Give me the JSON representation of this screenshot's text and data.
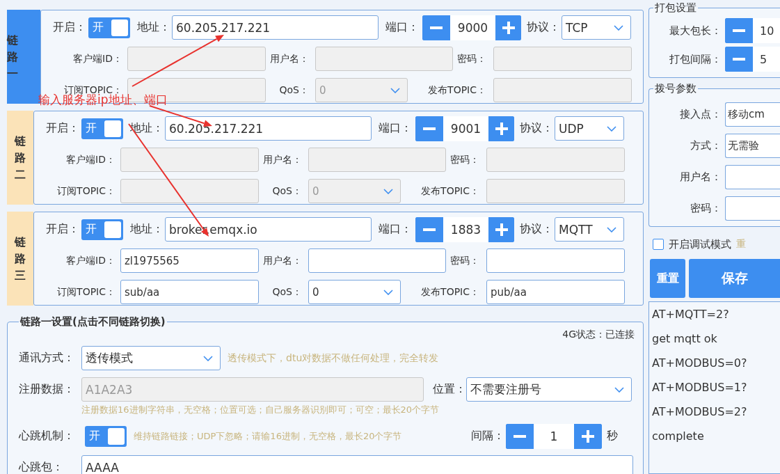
{
  "links": [
    {
      "tab": "链路一",
      "selected": true,
      "enabled": true,
      "switch_text": "开",
      "enable_label": "开启：",
      "address_label": "地址：",
      "address": "60.205.217.221",
      "port_label": "端口：",
      "port": "9000",
      "protocol_label": "协议：",
      "protocol": "TCP",
      "client_id_label": "客户端ID：",
      "username_label": "用户名：",
      "password_label": "密码：",
      "sub_topic_label": "订阅TOPIC：",
      "qos_label": "QoS：",
      "qos": "0",
      "pub_topic_label": "发布TOPIC：",
      "mqtt_disabled": true
    },
    {
      "tab": "链路二",
      "selected": false,
      "enabled": true,
      "switch_text": "开",
      "enable_label": "开启：",
      "address_label": "地址：",
      "address": "60.205.217.221",
      "port_label": "端口：",
      "port": "9001",
      "protocol_label": "协议：",
      "protocol": "UDP",
      "client_id_label": "客户端ID：",
      "username_label": "用户名：",
      "password_label": "密码：",
      "sub_topic_label": "订阅TOPIC：",
      "qos_label": "QoS：",
      "qos": "0",
      "pub_topic_label": "发布TOPIC：",
      "mqtt_disabled": true
    },
    {
      "tab": "链路三",
      "selected": false,
      "enabled": true,
      "switch_text": "开",
      "enable_label": "开启：",
      "address_label": "地址：",
      "address": "broker.emqx.io",
      "port_label": "端口：",
      "port": "1883",
      "protocol_label": "协议：",
      "protocol": "MQTT",
      "client_id_label": "客户端ID：",
      "client_id": "zl1975565",
      "username_label": "用户名：",
      "password_label": "密码：",
      "sub_topic_label": "订阅TOPIC：",
      "sub_topic": "sub/aa",
      "qos_label": "QoS：",
      "qos": "0",
      "pub_topic_label": "发布TOPIC：",
      "pub_topic": "pub/aa",
      "mqtt_disabled": false
    }
  ],
  "annotation": {
    "text": "输入服务器ip地址、端口"
  },
  "settings": {
    "legend": "链路一设置(点击不同链路切换)",
    "status": "4G状态：已连接",
    "mode_label": "通讯方式：",
    "mode": "透传模式",
    "mode_hint": "透传模式下，dtu对数据不做任何处理，完全转发",
    "reg_label": "注册数据：",
    "reg_value": "A1A2A3",
    "reg_disabled": true,
    "position_label": "位置：",
    "position": "不需要注册号",
    "reg_hint": "注册数据16进制字符串，无空格；位置可选；自己服务器识别即可；可空；最长20个字节",
    "heartbeat_label": "心跳机制：",
    "heartbeat_on": true,
    "heartbeat_switch_text": "开",
    "heartbeat_hint": "维持链路链接；UDP下忽略；请输16进制，无空格，最长20个字节",
    "interval_label": "间隔：",
    "interval": "1",
    "interval_unit": "秒",
    "packet_label": "心跳包：",
    "packet": "AAAA"
  },
  "packing": {
    "legend": "打包设置",
    "rows": [
      {
        "label": "最大包长：",
        "value": "10"
      },
      {
        "label": "打包间隔：",
        "value": "5"
      }
    ]
  },
  "dial": {
    "legend": "拨号参数",
    "rows": [
      {
        "label": "接入点：",
        "value": "移动cm"
      },
      {
        "label": "方式：",
        "value": "无需验"
      },
      {
        "label": "用户名："
      },
      {
        "label": "密码："
      }
    ]
  },
  "debug": {
    "label": "开启调试模式",
    "checked": false,
    "hint": "重"
  },
  "buttons": [
    "重置",
    "保存"
  ],
  "log": [
    "AT+MQTT=2?",
    "get mqtt ok",
    "AT+MODBUS=0?",
    "AT+MODBUS=1?",
    "AT+MODBUS=2?",
    "complete"
  ]
}
